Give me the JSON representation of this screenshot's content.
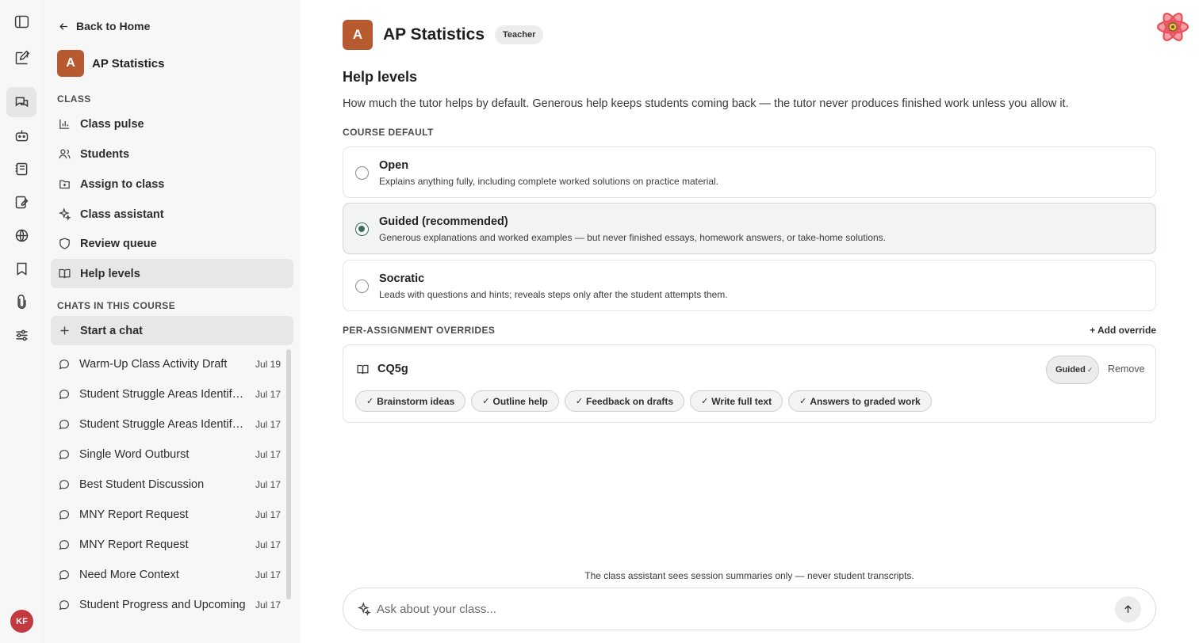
{
  "rail": {
    "avatar_initials": "KF",
    "icons": [
      "sidebar-toggle-icon",
      "compose-icon",
      "chats-icon",
      "bot-icon",
      "notebook-icon",
      "assignments-icon",
      "globe-icon",
      "bookmark-icon",
      "attachment-icon",
      "sliders-icon"
    ]
  },
  "sidebar": {
    "back_label": "Back to Home",
    "course_initial": "A",
    "course_name": "AP Statistics",
    "class_section_label": "CLASS",
    "nav": [
      {
        "label": "Class pulse",
        "icon": "chart-icon"
      },
      {
        "label": "Students",
        "icon": "users-icon"
      },
      {
        "label": "Assign to class",
        "icon": "assign-icon"
      },
      {
        "label": "Class assistant",
        "icon": "sparkle-icon"
      },
      {
        "label": "Review queue",
        "icon": "shield-icon"
      },
      {
        "label": "Help levels",
        "icon": "book-icon",
        "active": true
      }
    ],
    "chats_section_label": "CHATS IN THIS COURSE",
    "start_chat_label": "Start a chat",
    "chats": [
      {
        "title": "Warm-Up Class Activity Draft",
        "date": "Jul 19"
      },
      {
        "title": "Student Struggle Areas Identification",
        "date": "Jul 17"
      },
      {
        "title": "Student Struggle Areas Identification",
        "date": "Jul 17"
      },
      {
        "title": "Single Word Outburst",
        "date": "Jul 17"
      },
      {
        "title": "Best Student Discussion",
        "date": "Jul 17"
      },
      {
        "title": "MNY Report Request",
        "date": "Jul 17"
      },
      {
        "title": "MNY Report Request",
        "date": "Jul 17"
      },
      {
        "title": "Need More Context",
        "date": "Jul 17"
      },
      {
        "title": "Student Progress and Upcoming",
        "date": "Jul 17"
      }
    ]
  },
  "header": {
    "course_initial": "A",
    "course_name": "AP Statistics",
    "role_badge": "Teacher"
  },
  "main": {
    "title": "Help levels",
    "description": "How much the tutor helps by default. Generous help keeps students coming back — the tutor never produces finished work unless you allow it.",
    "course_default_label": "COURSE DEFAULT",
    "options": [
      {
        "title": "Open",
        "desc": "Explains anything fully, including complete worked solutions on practice material.",
        "selected": false
      },
      {
        "title": "Guided (recommended)",
        "desc": "Generous explanations and worked examples — but never finished essays, homework answers, or take-home solutions.",
        "selected": true
      },
      {
        "title": "Socratic",
        "desc": "Leads with questions and hints; reveals steps only after the student attempts them.",
        "selected": false
      }
    ],
    "overrides_label": "PER-ASSIGNMENT OVERRIDES",
    "add_override_label": "+ Add override",
    "override": {
      "name": "CQ5g",
      "level": "Guided",
      "remove_label": "Remove",
      "chips": [
        "Brainstorm ideas",
        "Outline help",
        "Feedback on drafts",
        "Write full text",
        "Answers to graded work"
      ]
    },
    "footer_note": "The class assistant sees session summaries only — never student transcripts.",
    "composer_placeholder": "Ask about your class..."
  },
  "colors": {
    "accent_badge": "#b85a2f",
    "radio_selected": "#3d6b58",
    "avatar": "#c2393f"
  }
}
